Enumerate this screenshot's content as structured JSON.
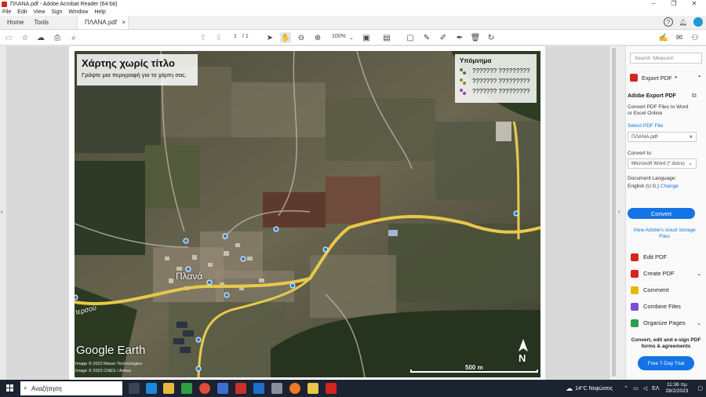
{
  "window": {
    "title": "ΠΛΑΝΑ.pdf - Adobe Acrobat Reader (64-bit)",
    "minimize": "–",
    "maximize": "❐",
    "close": "✕"
  },
  "menu": [
    "File",
    "Edit",
    "View",
    "Sign",
    "Window",
    "Help"
  ],
  "tabs": {
    "home": "Home",
    "tools": "Tools",
    "document": "ΠΛΑΝΑ.pdf",
    "close": "×"
  },
  "toolbar": {
    "page_current": "1",
    "page_total": "/ 1",
    "zoom": "100%"
  },
  "map": {
    "title": "Χάρτης χωρίς τίτλο",
    "subtitle": "Γράψτε μια περιγραφή για το χάρτη σας.",
    "legend_title": "Υπόμνημα",
    "legend_items": [
      {
        "label": "??????? ?????????",
        "color": "#4a7a3a"
      },
      {
        "label": "??????? ?????????",
        "color": "#8a8a2a"
      },
      {
        "label": "??????? ?????????",
        "color": "#a040b0"
      }
    ],
    "village_label": "Πλανά",
    "road_label": "Ιερσού",
    "logo": "Google Earth",
    "copyright_1": "Image © 2023 Maxar Technologies",
    "copyright_2": "Image © 2023 CNES / Airbus",
    "scale_label": "500 m",
    "north_label": "N"
  },
  "right_panel": {
    "search_placeholder": "Search 'Measure'",
    "export_heading": "Export PDF",
    "adobe_export_title": "Adobe Export PDF",
    "adobe_export_desc": "Convert PDF Files to Word or Excel Online",
    "select_pdf_label": "Select PDF File",
    "selected_file": "ΠΛΑΝΑ.pdf",
    "convert_to_label": "Convert to",
    "convert_to_value": "Microsoft Word (*.docx)",
    "doc_lang_label": "Document Language:",
    "doc_lang_value": "English (U.S.)",
    "change_link": "Change",
    "convert_button": "Convert",
    "cloud_link": "View Adobe's cloud storage Files",
    "tools": [
      {
        "label": "Edit PDF",
        "color": "#d4251d"
      },
      {
        "label": "Create PDF",
        "color": "#d4251d"
      },
      {
        "label": "Comment",
        "color": "#e6b800"
      },
      {
        "label": "Combine Files",
        "color": "#7b4fd6"
      },
      {
        "label": "Organize Pages",
        "color": "#2e9e4a"
      }
    ],
    "promo_text": "Convert, edit and e-sign PDF forms & agreements",
    "trial_button": "Free 7-Day Trial"
  },
  "taskbar": {
    "search_text": "Αναζήτηση",
    "weather": "14°C  Νεφώσεις",
    "language": "ΕΛ",
    "time": "11:36 πμ",
    "date": "28/2/2023"
  }
}
